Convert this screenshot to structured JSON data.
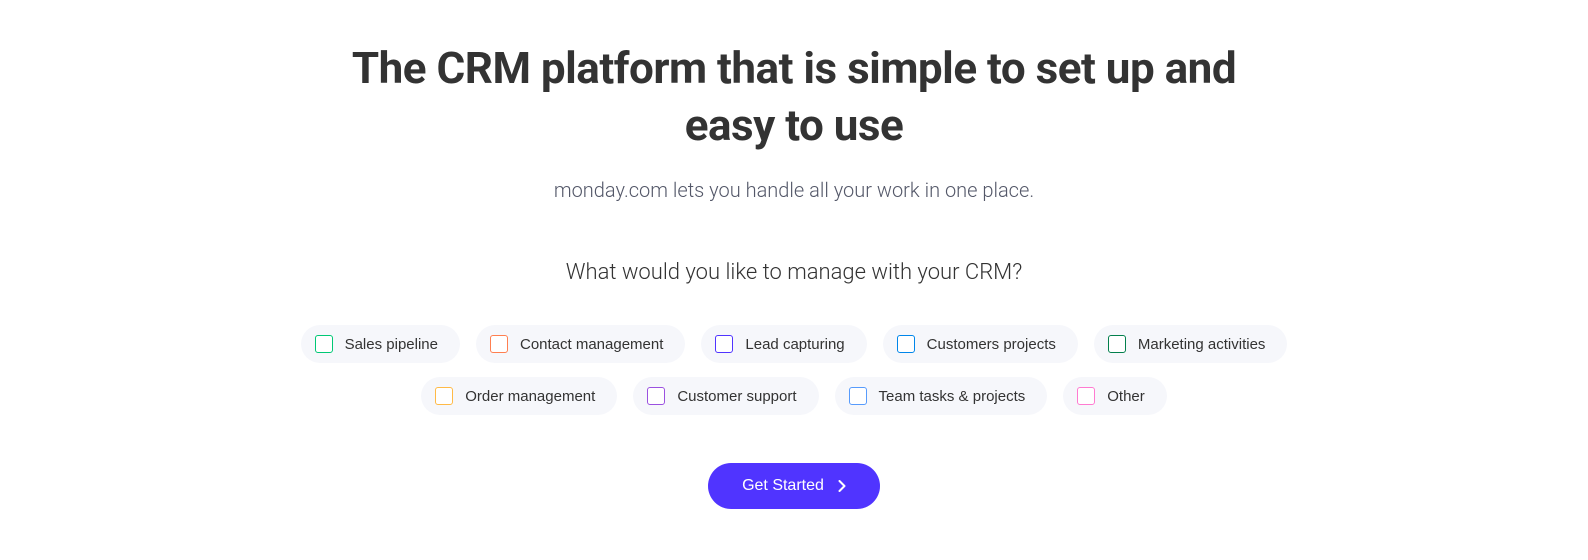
{
  "headline": "The CRM platform that is simple to set up and easy to use",
  "subheadline": "monday.com lets you handle all your work in one place.",
  "question": "What would you like to manage with your CRM?",
  "options": {
    "row1": [
      {
        "label": "Sales pipeline",
        "color": "teal"
      },
      {
        "label": "Contact management",
        "color": "coral"
      },
      {
        "label": "Lead capturing",
        "color": "indigo"
      },
      {
        "label": "Customers projects",
        "color": "blue"
      },
      {
        "label": "Marketing activities",
        "color": "green"
      }
    ],
    "row2": [
      {
        "label": "Order management",
        "color": "orange"
      },
      {
        "label": "Customer support",
        "color": "purple"
      },
      {
        "label": "Team tasks & projects",
        "color": "skyblue"
      },
      {
        "label": "Other",
        "color": "pink"
      }
    ]
  },
  "cta": {
    "label": "Get Started"
  }
}
